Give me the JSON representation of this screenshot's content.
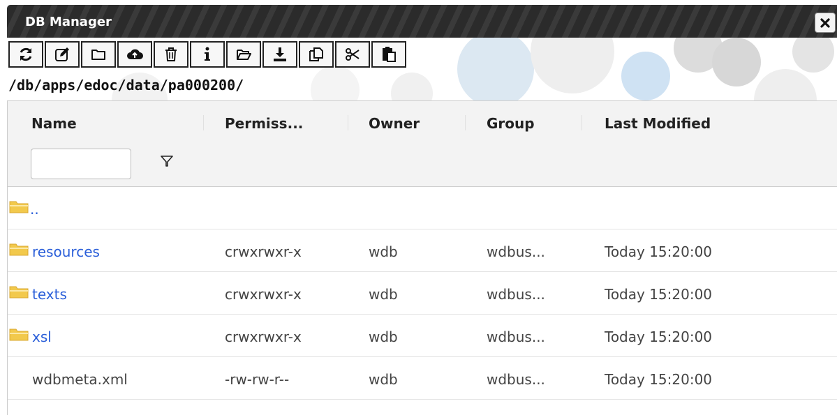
{
  "window": {
    "title": "DB Manager",
    "close_icon": "close-icon"
  },
  "toolbar": [
    {
      "name": "refresh-button",
      "icon": "refresh-icon"
    },
    {
      "name": "edit-button",
      "icon": "edit-icon"
    },
    {
      "name": "new-folder-button",
      "icon": "folder-icon"
    },
    {
      "name": "upload-button",
      "icon": "cloud-upload-icon"
    },
    {
      "name": "delete-button",
      "icon": "trash-icon"
    },
    {
      "name": "info-button",
      "icon": "info-icon"
    },
    {
      "name": "open-button",
      "icon": "folder-open-icon"
    },
    {
      "name": "download-button",
      "icon": "download-icon"
    },
    {
      "name": "copy-button",
      "icon": "copy-icon"
    },
    {
      "name": "cut-button",
      "icon": "scissors-icon"
    },
    {
      "name": "paste-button",
      "icon": "paste-icon"
    }
  ],
  "path": "/db/apps/edoc/data/pa000200/",
  "grid": {
    "columns": [
      "Name",
      "Permiss...",
      "Owner",
      "Group",
      "Last Modified"
    ],
    "filter": {
      "value": "",
      "icon": "filter-icon"
    },
    "rows": [
      {
        "name": "..",
        "is_folder": true,
        "permissions": "",
        "owner": "",
        "group": "",
        "modified": ""
      },
      {
        "name": "resources",
        "is_folder": true,
        "permissions": "crwxrwxr-x",
        "owner": "wdb",
        "group": "wdbus...",
        "modified": "Today 15:20:00"
      },
      {
        "name": "texts",
        "is_folder": true,
        "permissions": "crwxrwxr-x",
        "owner": "wdb",
        "group": "wdbus...",
        "modified": "Today 15:20:00"
      },
      {
        "name": "xsl",
        "is_folder": true,
        "permissions": "crwxrwxr-x",
        "owner": "wdb",
        "group": "wdbus...",
        "modified": "Today 15:20:00"
      },
      {
        "name": "wdbmeta.xml",
        "is_folder": false,
        "permissions": "-rw-rw-r--",
        "owner": "wdb",
        "group": "wdbus...",
        "modified": "Today 15:20:00"
      }
    ]
  },
  "colors": {
    "link": "#2b5fd9",
    "folder": "#f2c94c",
    "titlebar": "#2b2b2b"
  }
}
